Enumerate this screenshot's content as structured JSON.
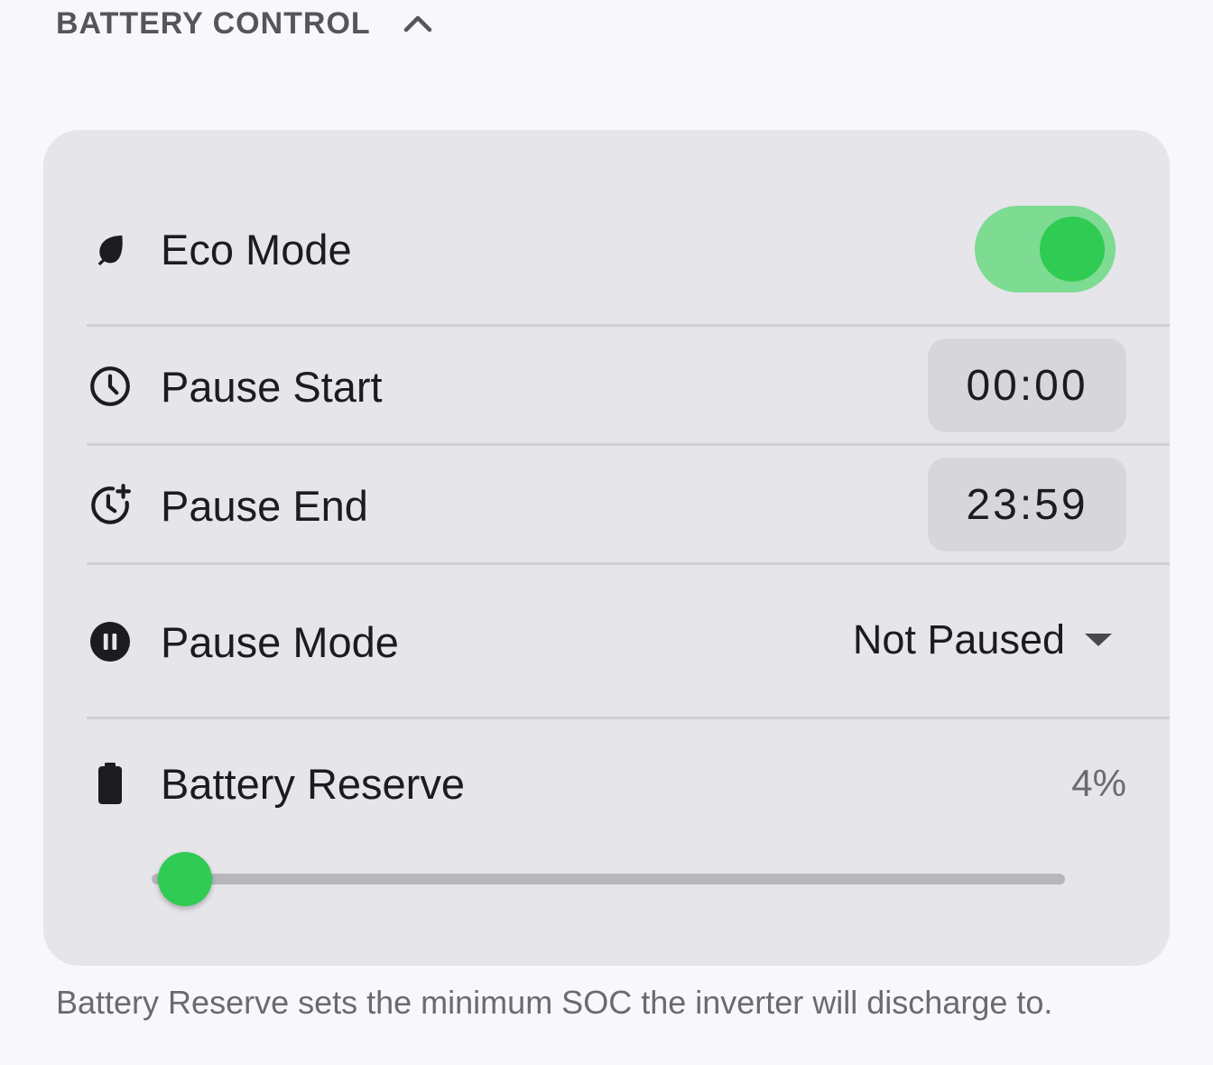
{
  "section": {
    "title": "BATTERY CONTROL",
    "expanded": true,
    "chevron_icon": "chevron-up-icon"
  },
  "eco_mode": {
    "label": "Eco Mode",
    "icon": "leaf-icon",
    "enabled": true
  },
  "pause_start": {
    "label": "Pause Start",
    "icon": "clock-icon",
    "value": "00:00"
  },
  "pause_end": {
    "label": "Pause End",
    "icon": "clock-plus-icon",
    "value": "23:59"
  },
  "pause_mode": {
    "label": "Pause Mode",
    "icon": "pause-circle-icon",
    "value": "Not Paused"
  },
  "battery_reserve": {
    "label": "Battery Reserve",
    "icon": "battery-icon",
    "value_text": "4%",
    "percent": 4
  },
  "footnote": "Battery Reserve sets the minimum SOC the inverter will discharge to.",
  "colors": {
    "accent": "#2fcb52",
    "toggle_track": "#7ddb92",
    "card_bg": "#e5e5ea",
    "page_bg": "#f8f8fc"
  }
}
